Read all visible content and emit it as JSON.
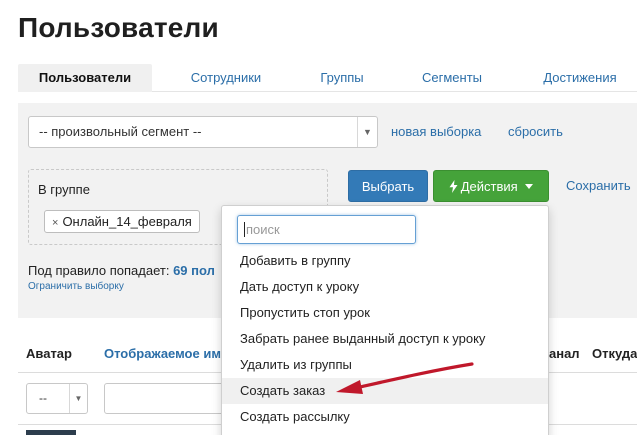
{
  "page": {
    "title": "Пользователи"
  },
  "tabs": [
    {
      "label": "Пользователи",
      "active": true
    },
    {
      "label": "Сотрудники",
      "active": false
    },
    {
      "label": "Группы",
      "active": false
    },
    {
      "label": "Сегменты",
      "active": false
    },
    {
      "label": "Достижения",
      "active": false
    }
  ],
  "filter": {
    "segment_value": "-- произвольный сегмент --",
    "new_selection": "новая выборка",
    "reset": "сбросить",
    "group_label": "В группе",
    "group_tag": "Онлайн_14_февраля",
    "tag_remove_glyph": "×",
    "choose_button": "Выбрать",
    "actions_button": "Действия",
    "actions_icon": "bolt-icon",
    "save_link": "Сохранить",
    "rule_text": "Под правило попадает:",
    "rule_count": "69 пол",
    "limit_link": "Ограничить выборку"
  },
  "table": {
    "headers": [
      "Аватар",
      "Отображаемое им",
      "анал",
      "Откуда"
    ],
    "avatar_filter_value": "--"
  },
  "dropdown": {
    "search_placeholder": "поиск",
    "items": [
      {
        "label": "Добавить в группу"
      },
      {
        "label": "Дать доступ к уроку"
      },
      {
        "label": "Пропустить стоп урок"
      },
      {
        "label": "Забрать ранее выданный доступ к уроку"
      },
      {
        "label": "Удалить из группы"
      },
      {
        "label": "Создать заказ",
        "highlighted": true
      },
      {
        "label": "Создать рассылку"
      }
    ]
  },
  "colors": {
    "link": "#2b6ea8",
    "primary_button": "#337ab7",
    "success_button": "#45a33a",
    "annotation_arrow": "#c0182b"
  }
}
